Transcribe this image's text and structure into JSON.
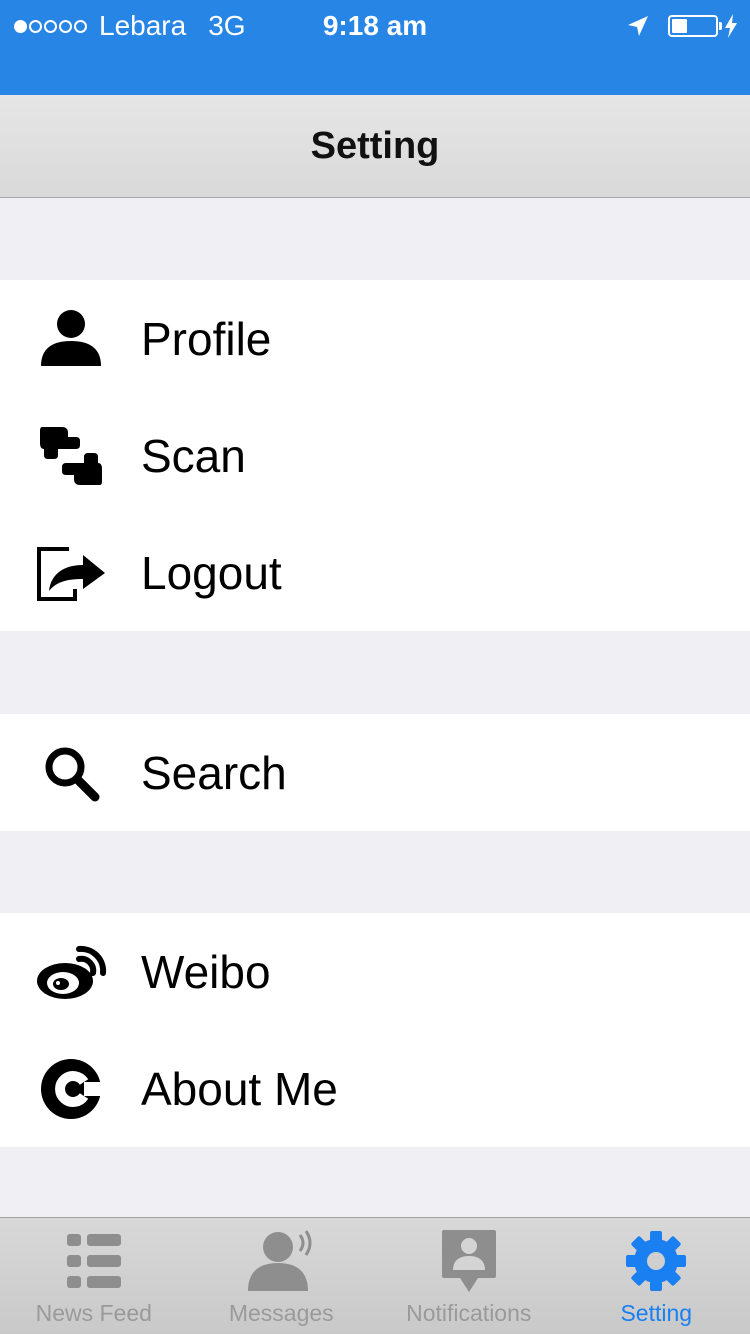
{
  "status_bar": {
    "carrier": "Lebara",
    "network": "3G",
    "time": "9:18 am",
    "signal_strength": 1,
    "battery_level_fraction": 0.35,
    "background_color": "#2785e6"
  },
  "nav": {
    "title": "Setting"
  },
  "groups": [
    {
      "items": [
        {
          "label": "Profile",
          "icon": "person-icon"
        },
        {
          "label": "Scan",
          "icon": "scan-icon"
        },
        {
          "label": "Logout",
          "icon": "logout-icon"
        }
      ]
    },
    {
      "items": [
        {
          "label": "Search",
          "icon": "search-icon"
        }
      ]
    },
    {
      "items": [
        {
          "label": "Weibo",
          "icon": "weibo-icon"
        },
        {
          "label": "About Me",
          "icon": "about-me-icon"
        }
      ]
    }
  ],
  "tabs": [
    {
      "label": "News Feed",
      "icon": "list-icon",
      "active": false
    },
    {
      "label": "Messages",
      "icon": "person-speaking-icon",
      "active": false
    },
    {
      "label": "Notifications",
      "icon": "contact-pin-icon",
      "active": false
    },
    {
      "label": "Setting",
      "icon": "gear-icon",
      "active": true
    }
  ],
  "colors": {
    "accent": "#1a7ff0",
    "inactive_tab": "#9a9a9a"
  }
}
